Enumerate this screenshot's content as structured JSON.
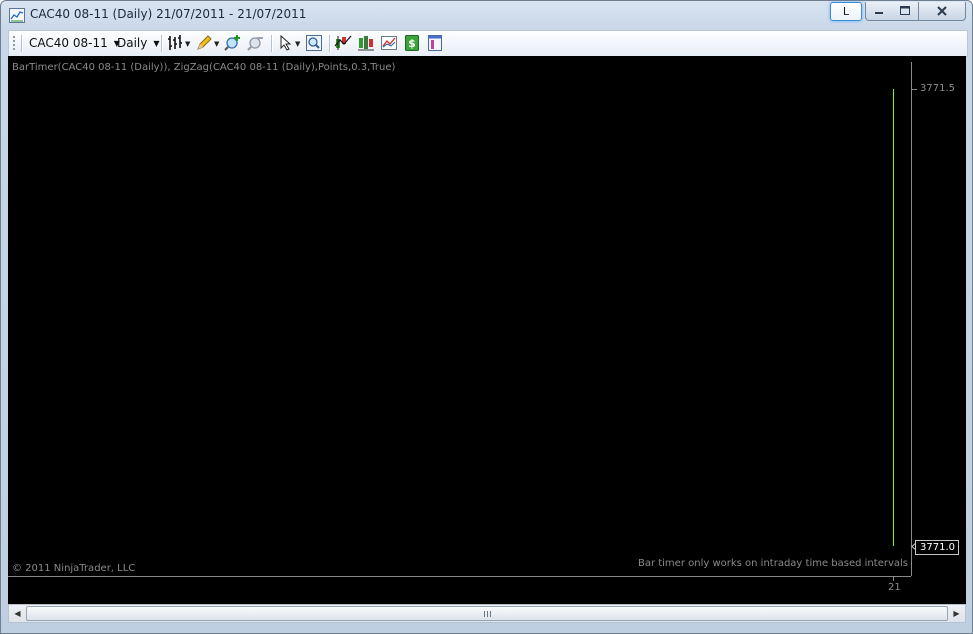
{
  "window": {
    "title": "CAC40 08-11 (Daily)  21/07/2011 - 21/07/2011",
    "link_button": "L",
    "icons": {
      "app": "chart-app-icon",
      "minimize": "minimize-icon",
      "maximize": "maximize-icon",
      "close": "close-icon"
    }
  },
  "toolbar": {
    "instrument": "CAC40 08-11",
    "interval": "Daily",
    "icons": [
      "bar-type-icon",
      "drawing-tool-pencil-icon",
      "zoom-in-icon",
      "zoom-out-icon",
      "cursor-pointer-icon",
      "data-box-magnifier-icon",
      "indicators-icon",
      "strategies-icon",
      "properties-icon",
      "order-entry-dollar-icon",
      "chart-trader-icon"
    ]
  },
  "chart": {
    "indicator_label": "BarTimer(CAC40 08-11 (Daily)), ZigZag(CAC40 08-11 (Daily),Points,0.3,True)",
    "copyright": "© 2011 NinjaTrader, LLC",
    "bar_timer_message": "Bar timer only works on intraday time based intervals",
    "last_price_label": "3771.0",
    "colors": {
      "background": "#000000",
      "text": "#8a8a8a",
      "bar": "#7cfc00"
    }
  },
  "chart_data": {
    "type": "bar",
    "categories": [
      "21"
    ],
    "series": [
      {
        "values": [
          {
            "high": 3771.5,
            "low": 3771.0
          }
        ]
      }
    ],
    "y_tick_labels": [
      "3771.5"
    ],
    "x_tick_labels": [
      "21"
    ],
    "ylim": [
      3771.0,
      3771.5
    ],
    "grid": false
  },
  "scrollbar": {
    "left_arrow": "◀",
    "right_arrow": "▶"
  }
}
